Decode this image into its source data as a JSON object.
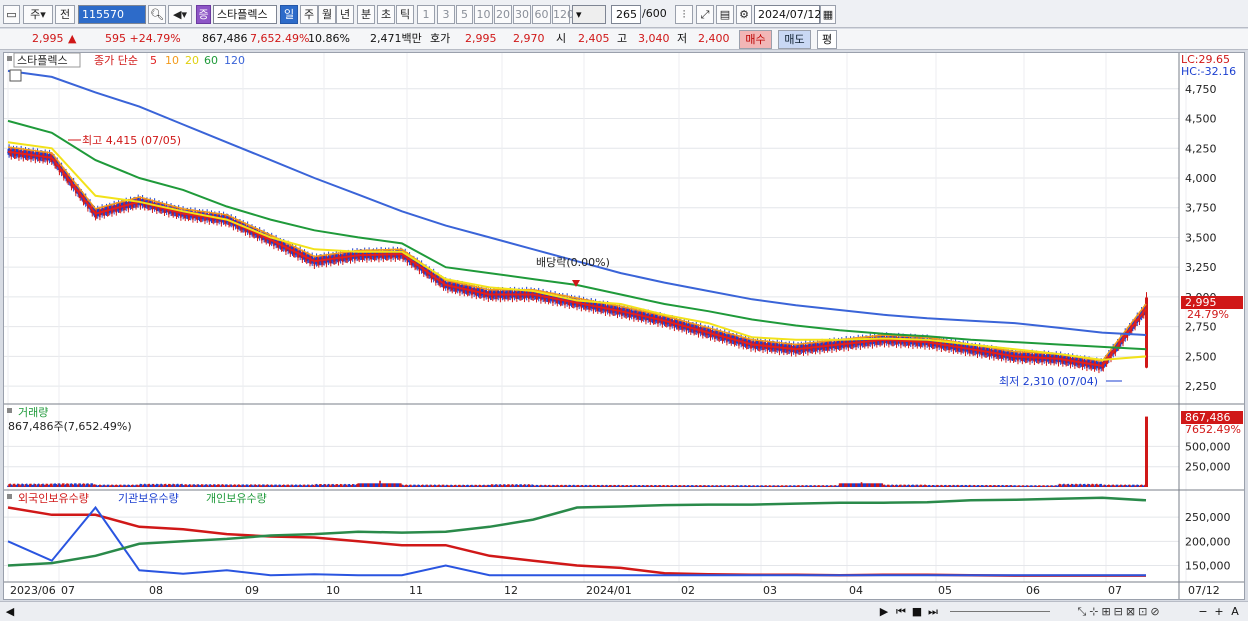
{
  "toolbar": {
    "mode": "주",
    "prev": "전",
    "code": "115570",
    "name": "스타플렉스",
    "icon_name": "증",
    "periods": [
      "일",
      "주",
      "월",
      "년",
      "분",
      "초",
      "틱"
    ],
    "active_period": "일",
    "nums": [
      "1",
      "3",
      "5",
      "10",
      "20",
      "30",
      "60",
      "120"
    ],
    "count": "265",
    "count_total": "/600",
    "date": "2024/07/12"
  },
  "quote": {
    "price": "2,995",
    "change": "595 +24.79%",
    "volume": "867,486",
    "vol_ratio": "7,652.49%",
    "turnover_ratio": "10.86%",
    "amount": "2,471백만",
    "hoga_label": "호가",
    "ask": "2,995",
    "bid": "2,970",
    "open_label": "시",
    "open": "2,405",
    "high_label": "고",
    "high": "3,040",
    "low_label": "저",
    "low": "2,400",
    "buy": "매수",
    "sell": "매도",
    "eval": "평"
  },
  "price_panel": {
    "legend_name": "스타플렉스",
    "legend_ma": "종가 단순",
    "ma_periods": [
      "5",
      "10",
      "20",
      "60",
      "120"
    ],
    "lc": "LC:29.65",
    "hc": "HC:-32.16",
    "high_note": "최고 4,415 (07/05)",
    "low_note": "최저 2,310 (07/04)",
    "dividend_note": "배당락(0.00%)",
    "last_price": "2,995",
    "last_pct": "24.79%",
    "y_ticks": [
      "4,750",
      "4,500",
      "4,250",
      "4,000",
      "3,750",
      "3,500",
      "3,250",
      "3,000",
      "2,750",
      "2,500",
      "2,250"
    ]
  },
  "volume_panel": {
    "title": "거래량",
    "info": "867,486주(7,652.49%)",
    "last": "867,486",
    "last_pct": "7652.49%",
    "y_ticks": [
      "500,000",
      "250,000"
    ]
  },
  "holding_panel": {
    "legend": [
      "외국인보유수량",
      "기관보유수량",
      "개인보유수량"
    ],
    "y_ticks": [
      "250,000",
      "200,000",
      "150,000"
    ]
  },
  "x_axis": [
    "2023/06",
    "07",
    "08",
    "09",
    "10",
    "11",
    "12",
    "2024/01",
    "02",
    "03",
    "04",
    "05",
    "06",
    "07",
    "07/12"
  ],
  "colors": {
    "up": "#d01818",
    "down": "#1b3fd0",
    "ma5": "#e02020",
    "ma10": "#f29a1a",
    "ma20": "#f2e21a",
    "ma60": "#1f9a3a",
    "ma120": "#3a64d8"
  },
  "chart_data": [
    {
      "type": "line",
      "title": "스타플렉스 일봉",
      "series": [
        {
          "name": "5",
          "values": [
            4220,
            4170,
            3700,
            3800,
            3700,
            3650,
            3480,
            3300,
            3350,
            3360,
            3100,
            3020,
            3020,
            2950,
            2880,
            2800,
            2700,
            2600,
            2560,
            2600,
            2640,
            2620,
            2560,
            2500,
            2480,
            2420,
            2900
          ]
        },
        {
          "name": "20",
          "values": [
            4300,
            4250,
            3850,
            3800,
            3720,
            3650,
            3500,
            3400,
            3380,
            3380,
            3150,
            3080,
            3050,
            2970,
            2940,
            2850,
            2780,
            2660,
            2640,
            2640,
            2650,
            2640,
            2600,
            2560,
            2520,
            2470,
            2500
          ]
        },
        {
          "name": "60",
          "values": [
            4480,
            4380,
            4150,
            4000,
            3900,
            3760,
            3650,
            3560,
            3500,
            3450,
            3250,
            3200,
            3150,
            3100,
            3020,
            2940,
            2880,
            2810,
            2760,
            2720,
            2690,
            2670,
            2640,
            2620,
            2600,
            2580,
            2560
          ]
        },
        {
          "name": "120",
          "values": [
            4900,
            4850,
            4720,
            4600,
            4450,
            4300,
            4150,
            4000,
            3860,
            3720,
            3600,
            3500,
            3400,
            3300,
            3200,
            3120,
            3050,
            2980,
            2930,
            2890,
            2850,
            2820,
            2800,
            2780,
            2740,
            2700,
            2680
          ]
        }
      ],
      "ylim": [
        2150,
        4950
      ],
      "last": 2995,
      "high": 4415,
      "low": 2310
    },
    {
      "type": "bar",
      "title": "거래량",
      "values": [
        42000,
        48000,
        30000,
        40000,
        35000,
        33000,
        31000,
        38000,
        140000,
        30000,
        28000,
        35000,
        27000,
        26000,
        25000,
        24000,
        23000,
        22000,
        23000,
        120000,
        30000,
        26000,
        25000,
        22000,
        40000,
        30000,
        867486
      ],
      "ylim": [
        0,
        850000
      ]
    },
    {
      "type": "line",
      "title": "보유수량",
      "series": [
        {
          "name": "외국인보유수량",
          "values": [
            270000,
            255000,
            255000,
            230000,
            225000,
            215000,
            210000,
            208000,
            200000,
            192000,
            192000,
            170000,
            160000,
            150000,
            145000,
            134000,
            132000,
            131000,
            131000,
            130000,
            131000,
            131000,
            130000,
            129000,
            129000,
            129000,
            129000
          ]
        },
        {
          "name": "기관보유수량",
          "values": [
            200000,
            160000,
            270000,
            140000,
            133000,
            140000,
            130000,
            132000,
            130000,
            130000,
            150000,
            130000,
            130000,
            130000,
            130000,
            130000,
            130000,
            130000,
            130000,
            130000,
            130000,
            130000,
            130000,
            130000,
            130000,
            130000,
            130000
          ]
        },
        {
          "name": "개인보유수량",
          "values": [
            150000,
            155000,
            170000,
            195000,
            200000,
            205000,
            212000,
            215000,
            220000,
            218000,
            220000,
            230000,
            245000,
            270000,
            272000,
            275000,
            276000,
            276000,
            278000,
            280000,
            280000,
            281000,
            285000,
            286000,
            288000,
            290000,
            285000
          ]
        }
      ],
      "ylim": [
        120000,
        300000
      ]
    }
  ]
}
